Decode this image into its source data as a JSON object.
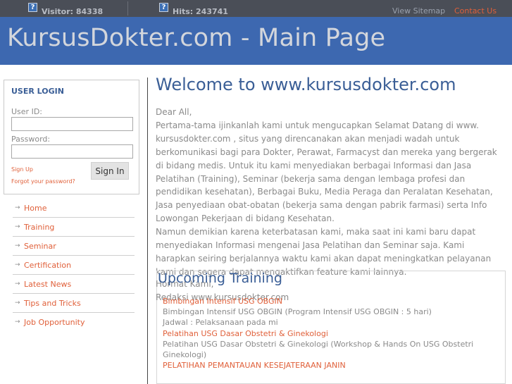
{
  "topbar": {
    "visitor_label": "Visitor: 84338",
    "hits_label": "Hits: 243741",
    "sitemap_label": "View Sitemap",
    "contact_label": "Contact Us",
    "stat_icon_glyph": "?"
  },
  "header": {
    "title": "KursusDokter.com - Main Page"
  },
  "login": {
    "heading": "USER LOGIN",
    "user_label": "User ID:",
    "password_label": "Password:",
    "signup_label": "Sign Up",
    "forgot_label": "Forgot your password?",
    "signin_label": "Sign In"
  },
  "nav": [
    {
      "label": "Home"
    },
    {
      "label": "Training"
    },
    {
      "label": "Seminar"
    },
    {
      "label": "Certification"
    },
    {
      "label": "Latest News"
    },
    {
      "label": "Tips and Tricks"
    },
    {
      "label": "Job Opportunity"
    }
  ],
  "main": {
    "title": "Welcome to www.kursusdokter.com",
    "lines": [
      "Dear All,",
      "Pertama-tama ijinkanlah kami untuk mengucapkan Selamat Datang di www.",
      "kursusdokter.com , situs yang direncanakan akan menjadi wadah untuk",
      "berkomunikasi bagi para Dokter, Perawat, Farmacyst dan mereka yang bergerak",
      "di bidang medis. Untuk itu kami menyediakan berbagai Informasi dan Jasa",
      "Pelatihan (Training), Seminar (bekerja sama dengan lembaga profesi dan",
      "pendidikan kesehatan), Berbagai Buku, Media Peraga dan  Peralatan Kesehatan,",
      "Jasa penyediaan obat-obatan (bekerja sama dengan pabrik farmasi) serta Info",
      "Lowongan Pekerjaan di bidang Kesehatan.",
      "Namun demikian karena keterbatasan kami, maka saat ini kami baru dapat",
      "menyediakan Informasi mengenai Jasa Pelatihan dan Seminar saja. Kami",
      "harapkan seiring berjalannya waktu kami akan dapat meningkatkan pelayanan",
      "kami dan segera dapat mengaktifkan feature kami lainnya."
    ],
    "signoff": "Hormat Kami,",
    "signature": "Redaksi www.kursusdokter.com"
  },
  "upcoming": {
    "heading": "Upcoming Training",
    "items": [
      {
        "title": "Bimbingan Intensif USG OBGIN",
        "desc": "Bimbingan Intensif USG OBGIN (Program Intensif USG OBGIN : 5 hari)",
        "desc2": "Jadwal : Pelaksanaan pada mi"
      },
      {
        "title": "Pelatihan USG Dasar Obstetri & Ginekologi",
        "desc": "Pelatihan USG Dasar Obstetri & Ginekologi (Workshop & Hands On USG Obstetri",
        "desc2": "Ginekologi)"
      },
      {
        "title": "PELATIHAN PEMANTAUAN KESEJATERAAN JANIN"
      }
    ]
  }
}
